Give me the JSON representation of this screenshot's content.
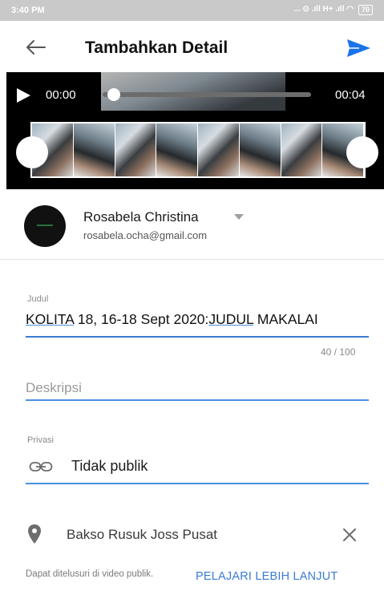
{
  "status_bar": {
    "time": "3:40 PM",
    "indicators": "... ⊙ .ıll H+ .ıll ◠",
    "battery": "70"
  },
  "app_bar": {
    "title": "Tambahkan Detail",
    "back_icon": "arrow-left-icon",
    "send_icon": "send-icon",
    "accent_color": "#1a73e8"
  },
  "player": {
    "current_time": "00:00",
    "duration": "00:04",
    "progress": 0,
    "play_icon": "play-icon",
    "frame_count": 8
  },
  "account": {
    "name": "Rosabela Christina",
    "email": "rosabela.ocha@gmail.com"
  },
  "form": {
    "title_label": "Judul",
    "title_parts": [
      "KOLITA",
      " 18, 16-18 Sept 2020:",
      "JUDUL",
      " MAKALAI"
    ],
    "title_counter": "40 / 100",
    "description_placeholder": "Deskripsi",
    "privacy_label": "Privasi",
    "privacy_value": "Tidak publik",
    "privacy_icon": "link-icon"
  },
  "location": {
    "name": "Bakso Rusuk Joss Pusat",
    "pin_icon": "location-pin-icon",
    "clear_icon": "close-icon"
  },
  "footer": {
    "note": "Dapat ditelusuri di video publik.",
    "learn_more": "PELAJARI LEBIH LANJUT"
  }
}
